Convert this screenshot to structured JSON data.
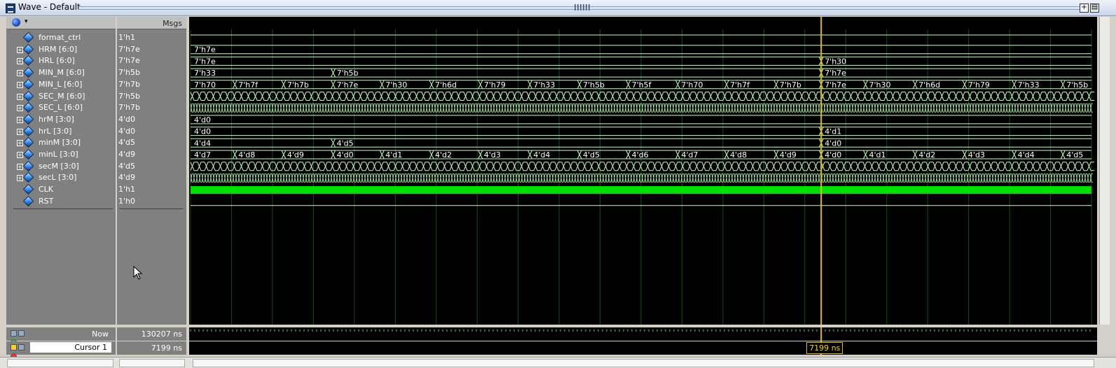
{
  "window": {
    "title": "Wave - Default"
  },
  "columns": {
    "msgs_label": "Msgs"
  },
  "signals": [
    {
      "name": "format_ctrl",
      "value": "1'h1",
      "expandable": false
    },
    {
      "name": "HRM [6:0]",
      "value": "7'h7e",
      "expandable": true
    },
    {
      "name": "HRL [6:0]",
      "value": "7'h7e",
      "expandable": true
    },
    {
      "name": "MIN_M [6:0]",
      "value": "7'h5b",
      "expandable": true
    },
    {
      "name": "MIN_L [6:0]",
      "value": "7'h7b",
      "expandable": true
    },
    {
      "name": "SEC_M [6:0]",
      "value": "7'h5b",
      "expandable": true
    },
    {
      "name": "SEC_L [6:0]",
      "value": "7'h7b",
      "expandable": true
    },
    {
      "name": "hrM [3:0]",
      "value": "4'd0",
      "expandable": true
    },
    {
      "name": "hrL [3:0]",
      "value": "4'd0",
      "expandable": true
    },
    {
      "name": "minM [3:0]",
      "value": "4'd5",
      "expandable": true
    },
    {
      "name": "minL [3:0]",
      "value": "4'd9",
      "expandable": true
    },
    {
      "name": "secM [3:0]",
      "value": "4'd5",
      "expandable": true
    },
    {
      "name": "secL [3:0]",
      "value": "4'd9",
      "expandable": true
    },
    {
      "name": "CLK",
      "value": "1'h1",
      "expandable": false
    },
    {
      "name": "RST",
      "value": "1'h0",
      "expandable": false
    }
  ],
  "waves": {
    "HRM": [
      {
        "t": 0,
        "label": "7'h7e"
      }
    ],
    "HRL": [
      {
        "t": 0,
        "label": "7'h7e"
      },
      {
        "t": 0.7,
        "label": "7'h30"
      }
    ],
    "MIN_M": [
      {
        "t": 0,
        "label": "7'h33"
      },
      {
        "t": 0.1583,
        "label": "7'h5b"
      },
      {
        "t": 0.7,
        "label": "7'h7e"
      }
    ],
    "MIN_L": [
      {
        "t": 0,
        "label": "7'h70"
      },
      {
        "t": 0.0492,
        "label": "7'h7f"
      },
      {
        "t": 0.1033,
        "label": "7'h7b"
      },
      {
        "t": 0.1583,
        "label": "7'h7e"
      },
      {
        "t": 0.2125,
        "label": "7'h30"
      },
      {
        "t": 0.2675,
        "label": "7'h6d"
      },
      {
        "t": 0.3217,
        "label": "7'h79"
      },
      {
        "t": 0.3767,
        "label": "7'h33"
      },
      {
        "t": 0.4317,
        "label": "7'h5b"
      },
      {
        "t": 0.4858,
        "label": "7'h5f"
      },
      {
        "t": 0.5408,
        "label": "7'h70"
      },
      {
        "t": 0.595,
        "label": "7'h7f"
      },
      {
        "t": 0.65,
        "label": "7'h7b"
      },
      {
        "t": 0.7,
        "label": "7'h7e"
      },
      {
        "t": 0.7492,
        "label": "7'h30"
      },
      {
        "t": 0.8042,
        "label": "7'h6d"
      },
      {
        "t": 0.8592,
        "label": "7'h79"
      },
      {
        "t": 0.9142,
        "label": "7'h33"
      },
      {
        "t": 0.9683,
        "label": "7'h5b"
      }
    ],
    "hrM": [
      {
        "t": 0,
        "label": "4'd0"
      }
    ],
    "hrL": [
      {
        "t": 0,
        "label": "4'd0"
      },
      {
        "t": 0.7,
        "label": "4'd1"
      }
    ],
    "minM": [
      {
        "t": 0,
        "label": "4'd4"
      },
      {
        "t": 0.1583,
        "label": "4'd5"
      },
      {
        "t": 0.7,
        "label": "4'd0"
      }
    ],
    "minL": [
      {
        "t": 0,
        "label": "4'd7"
      },
      {
        "t": 0.0492,
        "label": "4'd8"
      },
      {
        "t": 0.1033,
        "label": "4'd9"
      },
      {
        "t": 0.1583,
        "label": "4'd0"
      },
      {
        "t": 0.2125,
        "label": "4'd1"
      },
      {
        "t": 0.2675,
        "label": "4'd2"
      },
      {
        "t": 0.3217,
        "label": "4'd3"
      },
      {
        "t": 0.3767,
        "label": "4'd4"
      },
      {
        "t": 0.4317,
        "label": "4'd5"
      },
      {
        "t": 0.4858,
        "label": "4'd6"
      },
      {
        "t": 0.5408,
        "label": "4'd7"
      },
      {
        "t": 0.595,
        "label": "4'd8"
      },
      {
        "t": 0.65,
        "label": "4'd9"
      },
      {
        "t": 0.7,
        "label": "4'd0"
      },
      {
        "t": 0.7492,
        "label": "4'd1"
      },
      {
        "t": 0.8042,
        "label": "4'd2"
      },
      {
        "t": 0.8592,
        "label": "4'd3"
      },
      {
        "t": 0.9142,
        "label": "4'd4"
      },
      {
        "t": 0.9683,
        "label": "4'd5"
      }
    ]
  },
  "status": {
    "now_label": "Now",
    "now_value": "130207 ns",
    "cursor_label": "Cursor 1",
    "cursor_value": "7199 ns",
    "cursor_marker_label": "7199 ns",
    "cursor_position": 0.7
  },
  "colors": {
    "wave_background": "#000000",
    "signal_trace": "#c8ffc8",
    "clock_fill": "#00e000",
    "cursor_line": "#e2c000",
    "grid": "#1d4a1d"
  }
}
